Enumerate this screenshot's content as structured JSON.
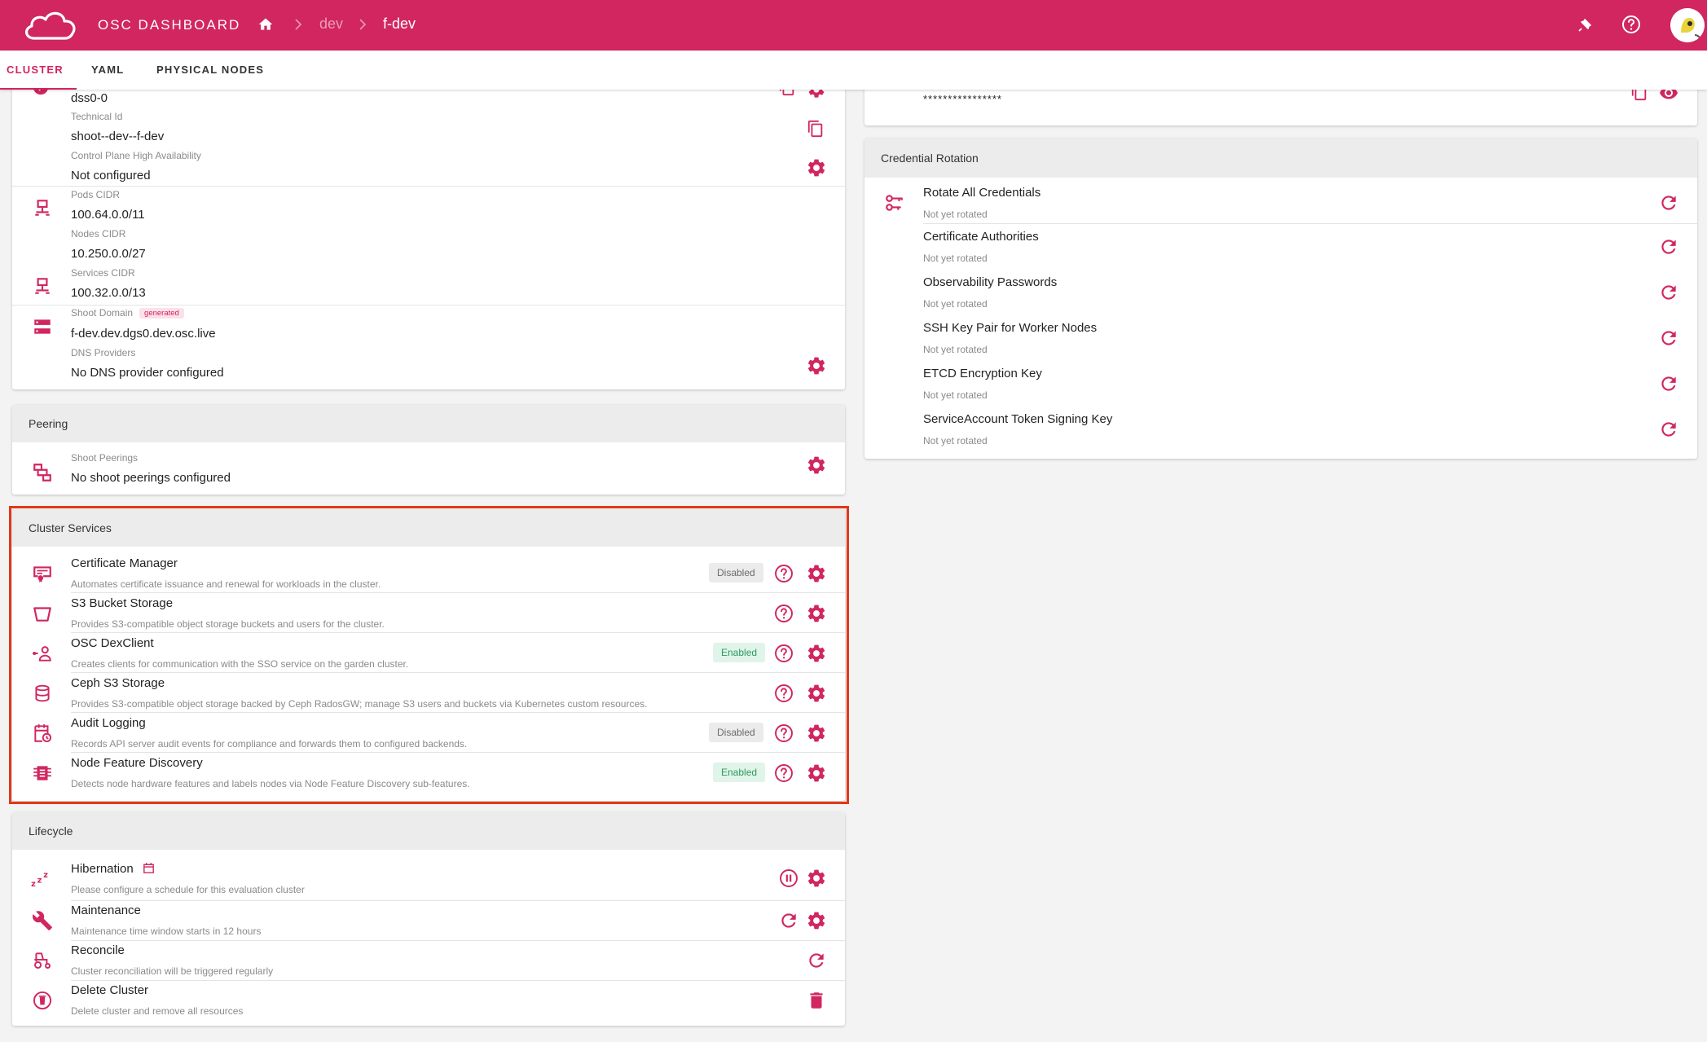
{
  "header": {
    "app_title": "OSC DASHBOARD",
    "breadcrumb": [
      "dev",
      "f-dev"
    ]
  },
  "tabs": [
    {
      "label": "CLUSTER",
      "active": true
    },
    {
      "label": "YAML",
      "active": false
    },
    {
      "label": "PHYSICAL NODES",
      "active": false
    }
  ],
  "infra": {
    "rows": [
      {
        "value": "dss0-0"
      },
      {
        "label": "Technical Id",
        "value": "shoot--dev--f-dev"
      },
      {
        "label": "Control Plane High Availability",
        "value": "Not configured"
      },
      {
        "label": "Pods CIDR",
        "value": "100.64.0.0/11"
      },
      {
        "label": "Nodes CIDR",
        "value": "10.250.0.0/27"
      },
      {
        "label": "Services CIDR",
        "value": "100.32.0.0/13"
      },
      {
        "label": "Shoot Domain",
        "tag": "generated",
        "value": "f-dev.dev.dgs0.dev.osc.live"
      },
      {
        "label": "DNS Providers",
        "value": "No DNS provider configured"
      }
    ]
  },
  "peering": {
    "title": "Peering",
    "label": "Shoot Peerings",
    "value": "No shoot peerings configured"
  },
  "cluster_services": {
    "title": "Cluster Services",
    "items": [
      {
        "name": "Certificate Manager",
        "desc": "Automates certificate issuance and renewal for workloads in the cluster.",
        "status": "Disabled"
      },
      {
        "name": "S3 Bucket Storage",
        "desc": "Provides S3-compatible object storage buckets and users for the cluster.",
        "status": ""
      },
      {
        "name": "OSC DexClient",
        "desc": "Creates clients for communication with the SSO service on the garden cluster.",
        "status": "Enabled"
      },
      {
        "name": "Ceph S3 Storage",
        "desc": "Provides S3-compatible object storage backed by Ceph RadosGW; manage S3 users and buckets via Kubernetes custom resources.",
        "status": ""
      },
      {
        "name": "Audit Logging",
        "desc": "Records API server audit events for compliance and forwards them to configured backends.",
        "status": "Disabled"
      },
      {
        "name": "Node Feature Discovery",
        "desc": "Detects node hardware features and labels nodes via Node Feature Discovery sub-features.",
        "status": "Enabled"
      }
    ]
  },
  "lifecycle": {
    "title": "Lifecycle",
    "items": [
      {
        "name": "Hibernation",
        "desc": "Please configure a schedule for this evaluation cluster"
      },
      {
        "name": "Maintenance",
        "desc": "Maintenance time window starts in 12 hours"
      },
      {
        "name": "Reconcile",
        "desc": "Cluster reconciliation will be triggered regularly"
      },
      {
        "name": "Delete Cluster",
        "desc": "Delete cluster and remove all resources"
      }
    ]
  },
  "secret": {
    "masked": "****************"
  },
  "credential_rotation": {
    "title": "Credential Rotation",
    "items": [
      {
        "name": "Rotate All Credentials",
        "status": "Not yet rotated"
      },
      {
        "name": "Certificate Authorities",
        "status": "Not yet rotated"
      },
      {
        "name": "Observability Passwords",
        "status": "Not yet rotated"
      },
      {
        "name": "SSH Key Pair for Worker Nodes",
        "status": "Not yet rotated"
      },
      {
        "name": "ETCD Encryption Key",
        "status": "Not yet rotated"
      },
      {
        "name": "ServiceAccount Token Signing Key",
        "status": "Not yet rotated"
      }
    ]
  },
  "colors": {
    "brand": "#d1265f",
    "highlight": "#e0391a",
    "enabled": "#2e9a5d"
  }
}
